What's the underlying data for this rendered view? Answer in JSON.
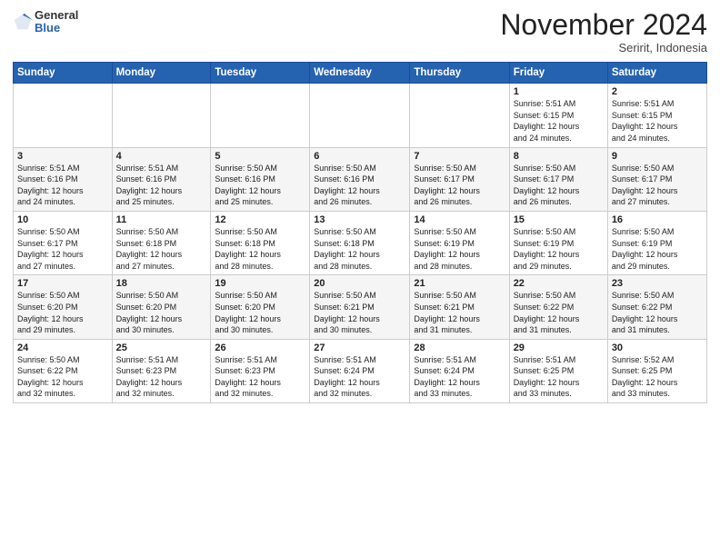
{
  "header": {
    "logo": {
      "general": "General",
      "blue": "Blue"
    },
    "month": "November 2024",
    "location": "Seririt, Indonesia"
  },
  "weekdays": [
    "Sunday",
    "Monday",
    "Tuesday",
    "Wednesday",
    "Thursday",
    "Friday",
    "Saturday"
  ],
  "weeks": [
    [
      {
        "day": "",
        "sunrise": "",
        "sunset": "",
        "daylight": ""
      },
      {
        "day": "",
        "sunrise": "",
        "sunset": "",
        "daylight": ""
      },
      {
        "day": "",
        "sunrise": "",
        "sunset": "",
        "daylight": ""
      },
      {
        "day": "",
        "sunrise": "",
        "sunset": "",
        "daylight": ""
      },
      {
        "day": "",
        "sunrise": "",
        "sunset": "",
        "daylight": ""
      },
      {
        "day": "1",
        "sunrise": "Sunrise: 5:51 AM",
        "sunset": "Sunset: 6:15 PM",
        "daylight": "Daylight: 12 hours and 24 minutes."
      },
      {
        "day": "2",
        "sunrise": "Sunrise: 5:51 AM",
        "sunset": "Sunset: 6:15 PM",
        "daylight": "Daylight: 12 hours and 24 minutes."
      }
    ],
    [
      {
        "day": "3",
        "sunrise": "Sunrise: 5:51 AM",
        "sunset": "Sunset: 6:16 PM",
        "daylight": "Daylight: 12 hours and 24 minutes."
      },
      {
        "day": "4",
        "sunrise": "Sunrise: 5:51 AM",
        "sunset": "Sunset: 6:16 PM",
        "daylight": "Daylight: 12 hours and 25 minutes."
      },
      {
        "day": "5",
        "sunrise": "Sunrise: 5:50 AM",
        "sunset": "Sunset: 6:16 PM",
        "daylight": "Daylight: 12 hours and 25 minutes."
      },
      {
        "day": "6",
        "sunrise": "Sunrise: 5:50 AM",
        "sunset": "Sunset: 6:16 PM",
        "daylight": "Daylight: 12 hours and 26 minutes."
      },
      {
        "day": "7",
        "sunrise": "Sunrise: 5:50 AM",
        "sunset": "Sunset: 6:17 PM",
        "daylight": "Daylight: 12 hours and 26 minutes."
      },
      {
        "day": "8",
        "sunrise": "Sunrise: 5:50 AM",
        "sunset": "Sunset: 6:17 PM",
        "daylight": "Daylight: 12 hours and 26 minutes."
      },
      {
        "day": "9",
        "sunrise": "Sunrise: 5:50 AM",
        "sunset": "Sunset: 6:17 PM",
        "daylight": "Daylight: 12 hours and 27 minutes."
      }
    ],
    [
      {
        "day": "10",
        "sunrise": "Sunrise: 5:50 AM",
        "sunset": "Sunset: 6:17 PM",
        "daylight": "Daylight: 12 hours and 27 minutes."
      },
      {
        "day": "11",
        "sunrise": "Sunrise: 5:50 AM",
        "sunset": "Sunset: 6:18 PM",
        "daylight": "Daylight: 12 hours and 27 minutes."
      },
      {
        "day": "12",
        "sunrise": "Sunrise: 5:50 AM",
        "sunset": "Sunset: 6:18 PM",
        "daylight": "Daylight: 12 hours and 28 minutes."
      },
      {
        "day": "13",
        "sunrise": "Sunrise: 5:50 AM",
        "sunset": "Sunset: 6:18 PM",
        "daylight": "Daylight: 12 hours and 28 minutes."
      },
      {
        "day": "14",
        "sunrise": "Sunrise: 5:50 AM",
        "sunset": "Sunset: 6:19 PM",
        "daylight": "Daylight: 12 hours and 28 minutes."
      },
      {
        "day": "15",
        "sunrise": "Sunrise: 5:50 AM",
        "sunset": "Sunset: 6:19 PM",
        "daylight": "Daylight: 12 hours and 29 minutes."
      },
      {
        "day": "16",
        "sunrise": "Sunrise: 5:50 AM",
        "sunset": "Sunset: 6:19 PM",
        "daylight": "Daylight: 12 hours and 29 minutes."
      }
    ],
    [
      {
        "day": "17",
        "sunrise": "Sunrise: 5:50 AM",
        "sunset": "Sunset: 6:20 PM",
        "daylight": "Daylight: 12 hours and 29 minutes."
      },
      {
        "day": "18",
        "sunrise": "Sunrise: 5:50 AM",
        "sunset": "Sunset: 6:20 PM",
        "daylight": "Daylight: 12 hours and 30 minutes."
      },
      {
        "day": "19",
        "sunrise": "Sunrise: 5:50 AM",
        "sunset": "Sunset: 6:20 PM",
        "daylight": "Daylight: 12 hours and 30 minutes."
      },
      {
        "day": "20",
        "sunrise": "Sunrise: 5:50 AM",
        "sunset": "Sunset: 6:21 PM",
        "daylight": "Daylight: 12 hours and 30 minutes."
      },
      {
        "day": "21",
        "sunrise": "Sunrise: 5:50 AM",
        "sunset": "Sunset: 6:21 PM",
        "daylight": "Daylight: 12 hours and 31 minutes."
      },
      {
        "day": "22",
        "sunrise": "Sunrise: 5:50 AM",
        "sunset": "Sunset: 6:22 PM",
        "daylight": "Daylight: 12 hours and 31 minutes."
      },
      {
        "day": "23",
        "sunrise": "Sunrise: 5:50 AM",
        "sunset": "Sunset: 6:22 PM",
        "daylight": "Daylight: 12 hours and 31 minutes."
      }
    ],
    [
      {
        "day": "24",
        "sunrise": "Sunrise: 5:50 AM",
        "sunset": "Sunset: 6:22 PM",
        "daylight": "Daylight: 12 hours and 32 minutes."
      },
      {
        "day": "25",
        "sunrise": "Sunrise: 5:51 AM",
        "sunset": "Sunset: 6:23 PM",
        "daylight": "Daylight: 12 hours and 32 minutes."
      },
      {
        "day": "26",
        "sunrise": "Sunrise: 5:51 AM",
        "sunset": "Sunset: 6:23 PM",
        "daylight": "Daylight: 12 hours and 32 minutes."
      },
      {
        "day": "27",
        "sunrise": "Sunrise: 5:51 AM",
        "sunset": "Sunset: 6:24 PM",
        "daylight": "Daylight: 12 hours and 32 minutes."
      },
      {
        "day": "28",
        "sunrise": "Sunrise: 5:51 AM",
        "sunset": "Sunset: 6:24 PM",
        "daylight": "Daylight: 12 hours and 33 minutes."
      },
      {
        "day": "29",
        "sunrise": "Sunrise: 5:51 AM",
        "sunset": "Sunset: 6:25 PM",
        "daylight": "Daylight: 12 hours and 33 minutes."
      },
      {
        "day": "30",
        "sunrise": "Sunrise: 5:52 AM",
        "sunset": "Sunset: 6:25 PM",
        "daylight": "Daylight: 12 hours and 33 minutes."
      }
    ]
  ]
}
